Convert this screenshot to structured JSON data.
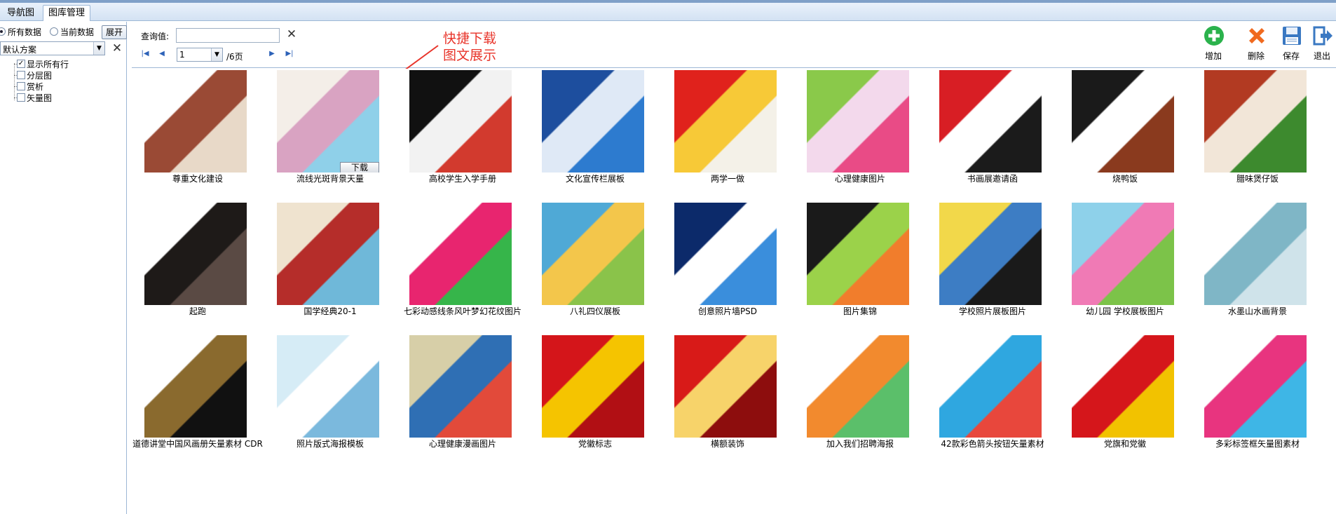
{
  "tabs": [
    {
      "label": "导航图",
      "active": false
    },
    {
      "label": "图库管理",
      "active": true
    }
  ],
  "left": {
    "radio_all": "所有数据",
    "radio_current": "当前数据",
    "selected_radio": "所有数据",
    "expand_label": "展开",
    "scheme": "默认方案",
    "tree": [
      {
        "label": "显示所有行",
        "checked": true
      },
      {
        "label": "分层图",
        "checked": false
      },
      {
        "label": "赏析",
        "checked": false
      },
      {
        "label": "矢量图",
        "checked": false
      }
    ]
  },
  "toolbar": {
    "query_label": "查询值:",
    "query_value": "",
    "page_value": "1",
    "total_pages": "/6页",
    "annotation_line1": "快捷下载",
    "annotation_line2": "图文展示",
    "buttons": [
      {
        "label": "增加",
        "icon": "add-icon",
        "color": "#2bb24c"
      },
      {
        "label": "删除",
        "icon": "delete-icon",
        "color": "#f06a1f"
      },
      {
        "label": "保存",
        "icon": "save-icon",
        "color": "#3a78c2"
      },
      {
        "label": "退出",
        "icon": "exit-icon",
        "color": "#3a78c2"
      }
    ]
  },
  "download_label": "下载",
  "gallery": [
    [
      {
        "caption": "尊重文化建设",
        "colors": [
          "#ffffff",
          "#9a4a35",
          "#e8d9c8"
        ]
      },
      {
        "caption": "流线光斑背景天量",
        "colors": [
          "#f4eee8",
          "#d9a3c2",
          "#8fd0e9"
        ],
        "download": true
      },
      {
        "caption": "高校学生入学手册",
        "colors": [
          "#111111",
          "#f2f2f2",
          "#d23a2e"
        ]
      },
      {
        "caption": "文化宣传栏展板",
        "colors": [
          "#1d4e9e",
          "#dfe9f6",
          "#2d7bcf"
        ]
      },
      {
        "caption": "两学一做",
        "colors": [
          "#e0221c",
          "#f7c937",
          "#f4f1e8"
        ]
      },
      {
        "caption": "心理健康图片",
        "colors": [
          "#8ac94a",
          "#f3d9ec",
          "#e94b86"
        ]
      },
      {
        "caption": "书画展邀请函",
        "colors": [
          "#d81e24",
          "#ffffff",
          "#1b1b1b"
        ]
      },
      {
        "caption": "烧鸭饭",
        "colors": [
          "#1a1a1a",
          "#ffffff",
          "#8a3a1e"
        ]
      },
      {
        "caption": "腊味煲仔饭",
        "colors": [
          "#b23a22",
          "#f2e6d8",
          "#3d8a2e"
        ]
      }
    ],
    [
      {
        "caption": "起跑",
        "colors": [
          "#ffffff",
          "#1e1a18",
          "#5a4a44"
        ]
      },
      {
        "caption": "国学经典20-1",
        "colors": [
          "#efe3cf",
          "#b52d2a",
          "#6fb8d9"
        ]
      },
      {
        "caption": "七彩动感线条风叶梦幻花纹图片",
        "colors": [
          "#ffffff",
          "#e8256f",
          "#36b54a"
        ]
      },
      {
        "caption": "八礼四仪展板",
        "colors": [
          "#4fa9d6",
          "#f3c64b",
          "#8ac34a"
        ]
      },
      {
        "caption": "创意照片墙PSD",
        "colors": [
          "#0c2a6a",
          "#ffffff",
          "#3a8edc"
        ]
      },
      {
        "caption": "图片集锦",
        "colors": [
          "#1a1a1a",
          "#9bd24a",
          "#f17d2c"
        ]
      },
      {
        "caption": "学校照片展板图片",
        "colors": [
          "#f2d84a",
          "#3d7dc4",
          "#1a1a1a"
        ]
      },
      {
        "caption": "幼儿园 学校展板图片",
        "colors": [
          "#8ed1ea",
          "#f07ab5",
          "#7cc349"
        ]
      },
      {
        "caption": "水墨山水画背景",
        "colors": [
          "#ffffff",
          "#7fb6c6",
          "#cfe3ea"
        ]
      }
    ],
    [
      {
        "caption": "道德讲堂中国风画册矢量素材 CDR",
        "colors": [
          "#ffffff",
          "#8a6a2e",
          "#111111"
        ]
      },
      {
        "caption": "照片版式海报模板",
        "colors": [
          "#d6ecf6",
          "#ffffff",
          "#7bb9dd"
        ]
      },
      {
        "caption": "心理健康漫画图片",
        "colors": [
          "#d7cfa8",
          "#2f6fb4",
          "#e24a3a"
        ]
      },
      {
        "caption": "党徽标志",
        "colors": [
          "#d4151a",
          "#f5c400",
          "#b10f14"
        ]
      },
      {
        "caption": "横额装饰",
        "colors": [
          "#d81a18",
          "#f7d36a",
          "#8d0d0d"
        ]
      },
      {
        "caption": "加入我们招聘海报",
        "colors": [
          "#ffffff",
          "#f28a2e",
          "#5bbf6a"
        ]
      },
      {
        "caption": "42款彩色箭头按钮矢量素材",
        "colors": [
          "#ffffff",
          "#2fa7e0",
          "#e8473c"
        ]
      },
      {
        "caption": "党旗和党徽",
        "colors": [
          "#ffffff",
          "#d5161b",
          "#f2c200"
        ]
      },
      {
        "caption": "多彩标签框矢量图素材",
        "colors": [
          "#ffffff",
          "#e8347f",
          "#3eb6e6"
        ]
      }
    ]
  ]
}
